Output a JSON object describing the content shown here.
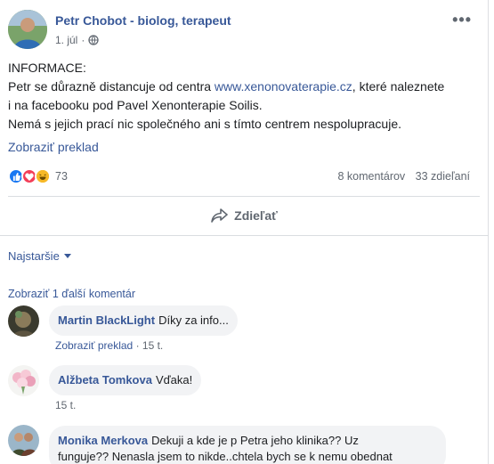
{
  "post": {
    "author": "Petr Chobot - biolog, terapeut",
    "date": "1. júl",
    "separator": "·",
    "privacy_icon": "globe-icon",
    "more_icon": "more-icon",
    "lines": {
      "l1": "INFORMACE:",
      "l2_pre": "Petr se důrazně distancuje od centra ",
      "l2_link": "www.xenonovaterapie.cz",
      "l2_post": ", které naleznete",
      "l3": "i na facebooku pod Pavel Xenonterapie Soilis.",
      "l4": "Nemá s jejich prací nic společného ani s tímto centrem nespolupracuje."
    },
    "translate": "Zobraziť preklad",
    "reaction_count": "73",
    "comments_count": "8 komentárov",
    "shares_count": "33 zdieľaní",
    "share_label": "Zdieľať",
    "sort_label": "Najstaršie",
    "more_comments": "Zobraziť 1 ďalší komentár"
  },
  "comments": [
    {
      "name": "Martin BlackLight",
      "text": "Díky za info...",
      "translate": "Zobraziť preklad",
      "sep": "·",
      "time": "15 t."
    },
    {
      "name": "Alžbeta Tomkova",
      "text": "Vďaka!",
      "time": "15 t."
    },
    {
      "name": "Monika Merkova",
      "text1": "Dekuji a kde je p Petra jeho klinika?? Uz",
      "text2": "funguje?? Nenasla jsem to nikde..chtela bych se k nemu obednat"
    }
  ],
  "colors": {
    "link": "#385898",
    "secondary": "#606770",
    "bubble": "#f2f3f5",
    "like": "#1877f2",
    "love": "#f33e58",
    "haha": "#f7b928"
  }
}
